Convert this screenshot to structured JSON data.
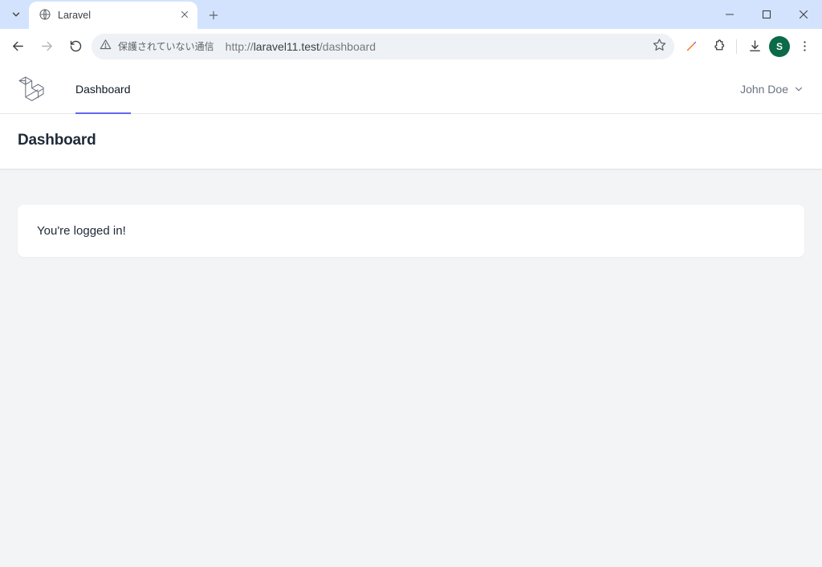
{
  "browser": {
    "tab_title": "Laravel",
    "security_warning": "保護されていない通信",
    "url_host": "laravel11.test",
    "url_path": "/dashboard",
    "url_protocol": "http://",
    "profile_initial": "S"
  },
  "app": {
    "nav_item": "Dashboard",
    "user_name": "John Doe",
    "page_title": "Dashboard",
    "card_message": "You're logged in!"
  }
}
